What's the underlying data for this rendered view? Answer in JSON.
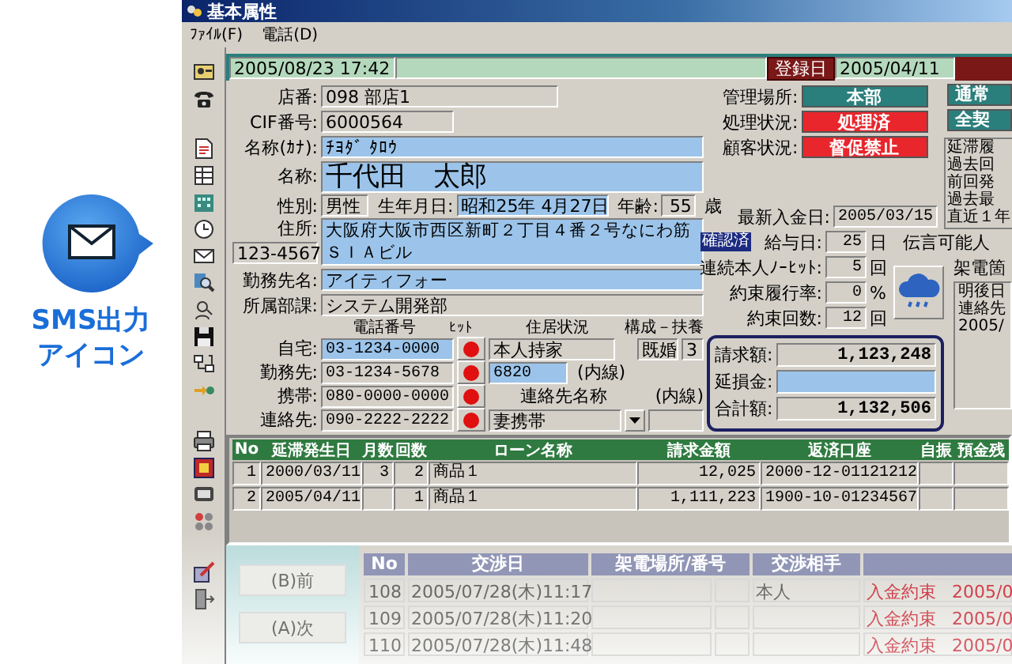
{
  "callout": {
    "lines": [
      "SMS出力",
      "アイコン"
    ]
  },
  "window": {
    "title": "基本属性"
  },
  "menu": [
    {
      "label": "ﾌｧｲﾙ(F)"
    },
    {
      "label": "電話(D)"
    }
  ],
  "header": {
    "datetime": "2005/08/23 17:42",
    "registered_label": "登録日",
    "registered_date": "2005/04/11"
  },
  "customer": {
    "branch": {
      "label": "店番:",
      "value": "098 部店1",
      "highlighted": false
    },
    "cif": {
      "label": "CIF番号:",
      "value": "6000564",
      "highlighted": false
    },
    "kana": {
      "label": "名称(ｶﾅ):",
      "value": "ﾁﾖﾀﾞ ﾀﾛｳ",
      "highlighted": true
    },
    "name": {
      "label": "名称:",
      "value": "千代田　太郎",
      "highlighted": true
    },
    "gender": {
      "label": "性別:",
      "value": "男性",
      "highlighted": false
    },
    "birth": {
      "label": "生年月日:",
      "value": "昭和25年 4月27日",
      "highlighted": true
    },
    "age": {
      "label": "年齢:",
      "value": "55",
      "unit": "歳",
      "highlighted": false
    },
    "address": {
      "label": "住所:",
      "postal": "123-4567",
      "lines": [
        "大阪府大阪市西区新町２丁目４番２号なにわ筋",
        "ＳＩＡビル"
      ],
      "badge": "確認済",
      "highlighted": true
    },
    "employer": {
      "label": "勤務先名:",
      "value": "アイティフォー",
      "highlighted": true
    },
    "department": {
      "label": "所属部課:",
      "value": "システム開発部",
      "highlighted": false
    }
  },
  "phones": {
    "headers": {
      "number": "電話番号",
      "hit": "ﾋｯﾄ",
      "housing": "住居状況",
      "family": "構成－扶養",
      "contact_name": "連絡先名称",
      "extension": "(内線)"
    },
    "rows": [
      {
        "label": "自宅:",
        "number": "03-1234-0000",
        "highlighted": true
      },
      {
        "label": "勤務先:",
        "number": "03-1234-5678",
        "highlighted": false
      },
      {
        "label": "携帯:",
        "number": "080-0000-0000",
        "highlighted": false
      },
      {
        "label": "連絡先:",
        "number": "090-2222-2222",
        "highlighted": false
      }
    ],
    "housing": "本人持家",
    "marital": "既婚",
    "dependents": "3",
    "extension": {
      "value": "6820",
      "label": "(内線)",
      "highlighted": true
    },
    "contact_name": "妻携帯"
  },
  "status": [
    {
      "label": "管理場所:",
      "value": "本部",
      "color": "#2a7f7c"
    },
    {
      "label": "処理状況:",
      "value": "処理済",
      "color": "#e8262c"
    },
    {
      "label": "顧客状況:",
      "value": "督促禁止",
      "color": "#e8262c"
    }
  ],
  "side_buttons": [
    {
      "label": "通常"
    },
    {
      "label": "全契"
    }
  ],
  "history": {
    "title": "延滞履",
    "items": [
      "過去回",
      "前回発",
      "過去最",
      "直近１年"
    ]
  },
  "payment": [
    {
      "label": "最新入金日:",
      "value": "2005/03/15"
    },
    {
      "label": "給与日:",
      "value": "25",
      "unit": "日"
    },
    {
      "label": "連続本人ﾉｰﾋｯﾄ:",
      "value": "5",
      "unit": "回"
    },
    {
      "label": "約束履行率:",
      "value": "0",
      "unit": "%"
    },
    {
      "label": "約束回数:",
      "value": "12",
      "unit": "回"
    }
  ],
  "message": {
    "label": "伝言可能人",
    "call_label": "架電箇",
    "memo": [
      "明後日",
      "連絡先",
      "2005/"
    ]
  },
  "billing": [
    {
      "label": "請求額:",
      "value": "1,123,248",
      "highlighted": false
    },
    {
      "label": "延損金:",
      "highlighted": true
    },
    {
      "label": "合計額:",
      "value": "1,132,506",
      "highlighted": false
    }
  ],
  "loans": {
    "columns": [
      "No",
      "延滞発生日",
      "月数",
      "回数",
      "ローン名称",
      "請求金額",
      "返済口座",
      "自振",
      "預金残"
    ],
    "rows": [
      {
        "no": "1",
        "date": "2000/03/11",
        "months": "3",
        "count": "2",
        "loan": "商品１",
        "amount": "12,025",
        "account": "2000-12-01121212"
      },
      {
        "no": "2",
        "date": "2005/04/11",
        "count": "1",
        "loan": "商品１",
        "amount": "1,111,223",
        "account": "1900-10-01234567"
      }
    ]
  },
  "negotiation": {
    "buttons": [
      {
        "label": "(B)前"
      },
      {
        "label": "(A)次"
      }
    ],
    "columns": [
      "No",
      "交渉日",
      "架電場所/番号",
      "交渉相手"
    ],
    "rows": [
      {
        "no": "108",
        "date": "2005/07/28(木)11:17",
        "party": "本人",
        "result": "入金約束",
        "result_date": "2005/0"
      },
      {
        "no": "109",
        "date": "2005/07/28(木)11:20",
        "result": "入金約束",
        "result_date": "2005/0"
      },
      {
        "no": "110",
        "date": "2005/07/28(木)11:48",
        "result": "入金約束",
        "result_date": "2005/0"
      }
    ]
  }
}
